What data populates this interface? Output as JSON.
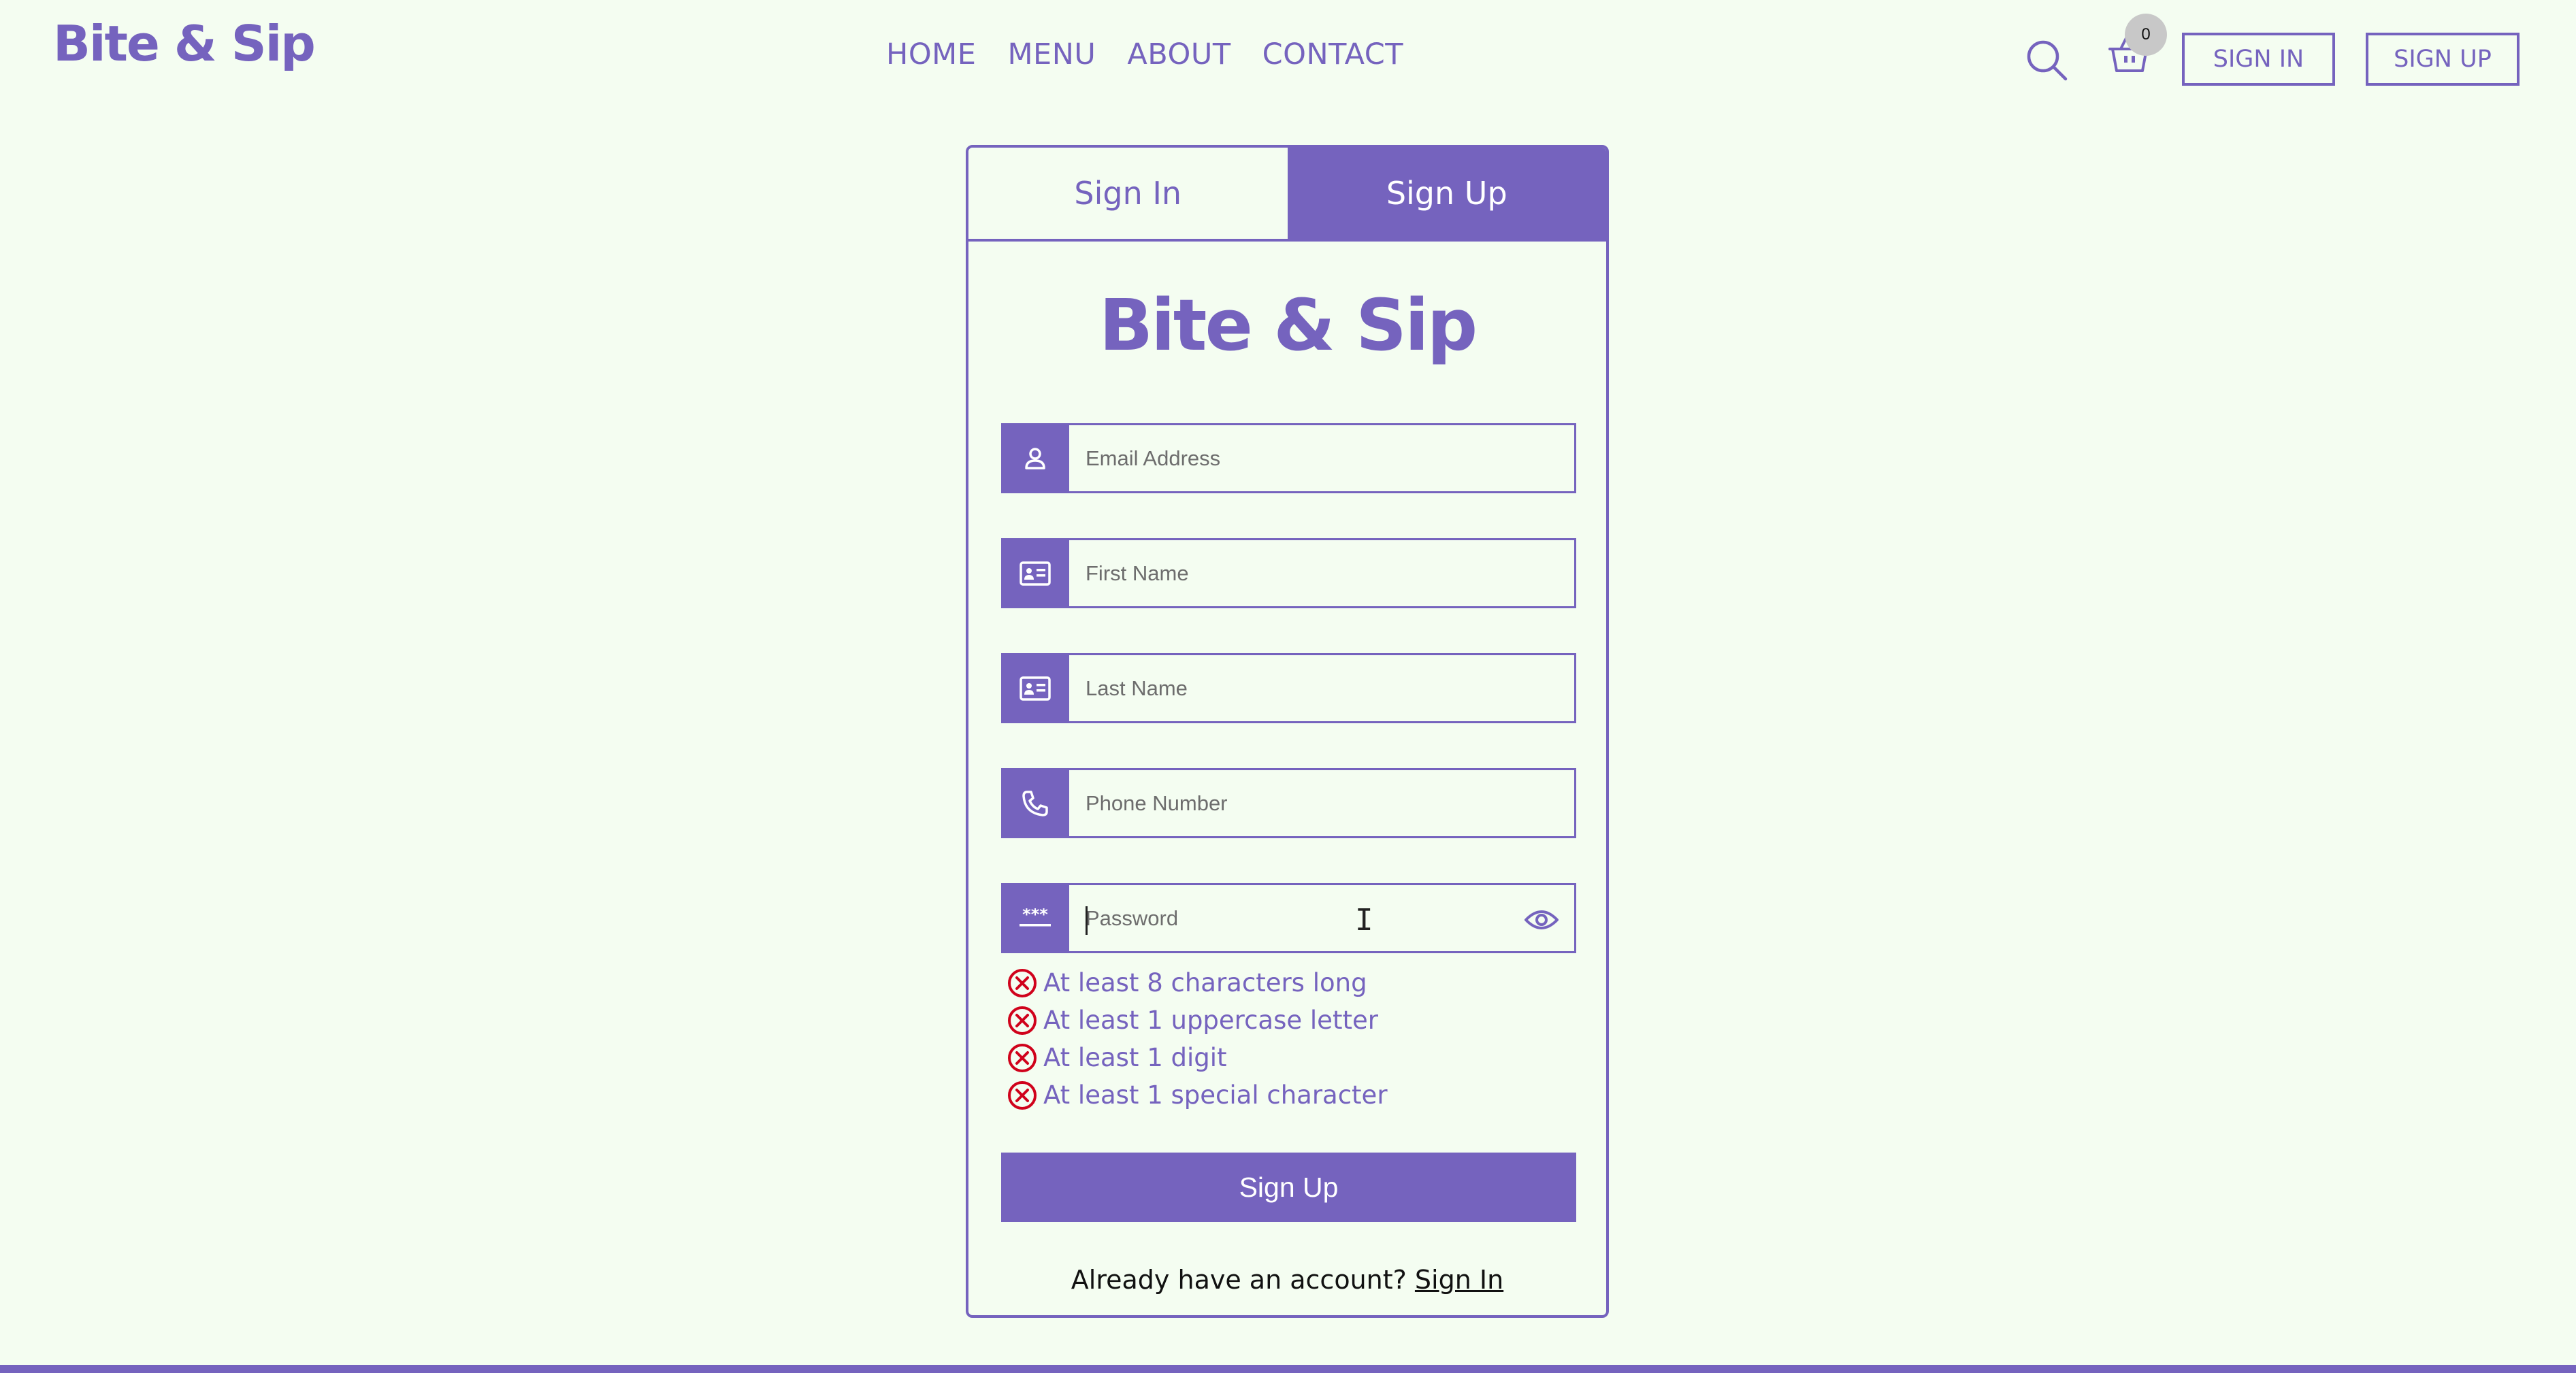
{
  "brand": "Bite & Sip",
  "nav": {
    "items": [
      "HOME",
      "MENU",
      "ABOUT",
      "CONTACT"
    ]
  },
  "header": {
    "cart_count": "0",
    "signin_label": "SIGN IN",
    "signup_label": "SIGN UP"
  },
  "card": {
    "tabs": [
      "Sign In",
      "Sign Up"
    ],
    "active_tab": "Sign Up",
    "logo": "Bite & Sip",
    "fields": {
      "email": {
        "placeholder": "Email Address",
        "value": "",
        "icon": "user-icon"
      },
      "first_name": {
        "placeholder": "First Name",
        "value": "",
        "icon": "id-card-icon"
      },
      "last_name": {
        "placeholder": "Last Name",
        "value": "",
        "icon": "id-card-icon"
      },
      "phone": {
        "placeholder": "Phone Number",
        "value": "",
        "icon": "phone-icon"
      },
      "password": {
        "placeholder": "Password",
        "value": "",
        "icon": "password-icon"
      }
    },
    "password_rules": [
      "At least 8 characters long",
      "At least 1 uppercase letter",
      "At least 1 digit",
      "At least 1 special character"
    ],
    "submit_label": "Sign Up",
    "footer_text": "Already have an account?",
    "footer_link": "Sign In"
  },
  "colors": {
    "accent": "#7563be",
    "background": "#f4fdf1",
    "error": "#d0021b"
  }
}
